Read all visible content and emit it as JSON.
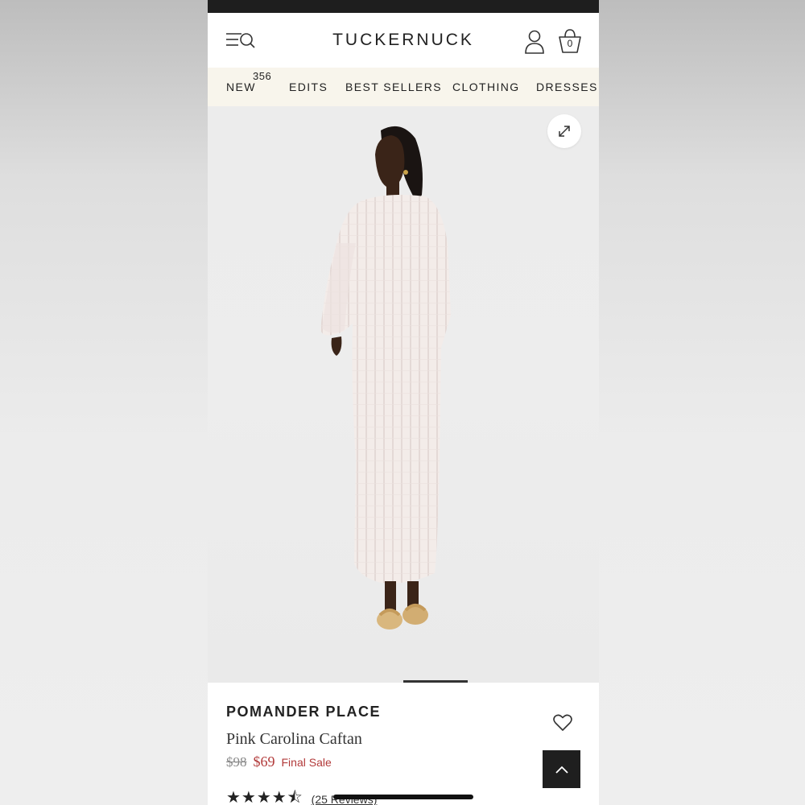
{
  "header": {
    "logo": "TUCKERNUCK",
    "bag_count": "0",
    "icons": {
      "menu": "menu-search-icon",
      "account": "user-icon",
      "bag": "shopping-bag-icon"
    }
  },
  "nav": {
    "items": [
      {
        "label": "NEW",
        "badge": "356"
      },
      {
        "label": "EDITS"
      },
      {
        "label": "BEST SELLERS"
      },
      {
        "label": "CLOTHING"
      },
      {
        "label": "DRESSES"
      }
    ]
  },
  "product": {
    "brand": "POMANDER PLACE",
    "name": "Pink Carolina Caftan",
    "original_price": "$98",
    "sale_price": "$69",
    "sale_note": "Final Sale",
    "rating": 4.5,
    "stars": "★★★★⯪",
    "reviews": "(25 Reviews)"
  },
  "colors": {
    "accent_sale": "#b23a3a",
    "nav_bg": "#f8f5ec",
    "dark": "#1f1f1f"
  }
}
